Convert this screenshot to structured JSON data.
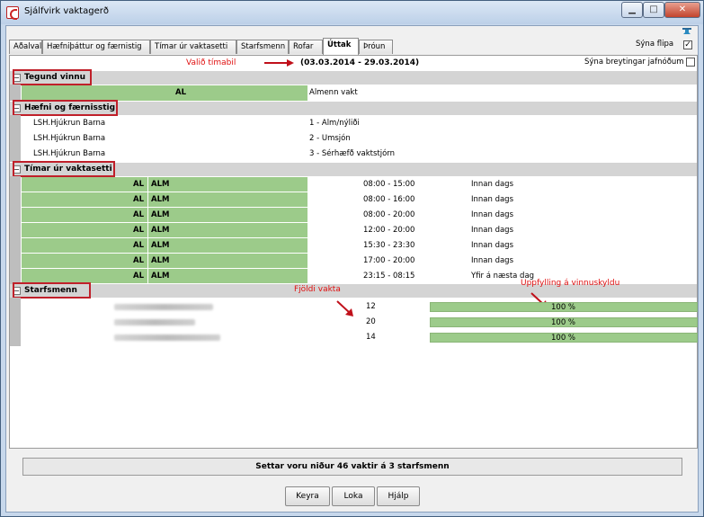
{
  "window": {
    "title": "Sjálfvirk vaktagerð",
    "minimize": "▁",
    "maximize": "□",
    "close": "✕"
  },
  "tabs": [
    {
      "label": "Aðalval"
    },
    {
      "label": "Hæfniþáttur og færnistig"
    },
    {
      "label": "Tímar úr vaktasetti"
    },
    {
      "label": "Starfsmenn"
    },
    {
      "label": "Rofar"
    },
    {
      "label": "Úttak"
    },
    {
      "label": "Þróun"
    }
  ],
  "toolbar": {
    "show_tabs_label": "Sýna flipa",
    "show_tabs_checked": "✓",
    "show_equal_changes_label": "Sýna breytingar jafnóðum"
  },
  "header": {
    "period_annotation": "Valið tímabil",
    "period": "(03.03.2014 - 29.03.2014)"
  },
  "sections": {
    "tegund": {
      "title": "Tegund vinnu",
      "rows": [
        {
          "code": "AL",
          "name": "Almenn vakt"
        }
      ]
    },
    "haefni": {
      "title": "Hæfni og færnisstig",
      "rows": [
        {
          "unit": "LSH.Hjúkrun Barna",
          "level": "1 - Alm/nýliði"
        },
        {
          "unit": "LSH.Hjúkrun Barna",
          "level": "2 - Umsjón"
        },
        {
          "unit": "LSH.Hjúkrun Barna",
          "level": "3 - Sérhæfð vaktstjórn"
        }
      ]
    },
    "timar": {
      "title": "Tímar úr vaktasetti",
      "rows": [
        {
          "code": "AL",
          "sub": "ALM",
          "time": "08:00 - 15:00",
          "type": "Innan dags"
        },
        {
          "code": "AL",
          "sub": "ALM",
          "time": "08:00 - 16:00",
          "type": "Innan dags"
        },
        {
          "code": "AL",
          "sub": "ALM",
          "time": "08:00 - 20:00",
          "type": "Innan dags"
        },
        {
          "code": "AL",
          "sub": "ALM",
          "time": "12:00 - 20:00",
          "type": "Innan dags"
        },
        {
          "code": "AL",
          "sub": "ALM",
          "time": "15:30 - 23:30",
          "type": "Innan dags"
        },
        {
          "code": "AL",
          "sub": "ALM",
          "time": "17:00 - 20:00",
          "type": "Innan dags"
        },
        {
          "code": "AL",
          "sub": "ALM",
          "time": "23:15 - 08:15",
          "type": "Yfir á næsta dag"
        }
      ]
    },
    "starfsmenn": {
      "title": "Starfsmenn",
      "annotation_shifts": "Fjöldi vakta",
      "annotation_fulfillment": "Uppfylling á vinnuskyldu",
      "rows": [
        {
          "shifts": "12",
          "fulfillment": "100 %",
          "fulfillment_value": 100
        },
        {
          "shifts": "20",
          "fulfillment": "100 %",
          "fulfillment_value": 100
        },
        {
          "shifts": "14",
          "fulfillment": "100 %",
          "fulfillment_value": 100
        }
      ]
    }
  },
  "status": "Settar voru niður 46 vaktir á 3 starfsmenn",
  "buttons": {
    "run": "Keyra",
    "close": "Loka",
    "help": "Hjálp"
  },
  "colors": {
    "green_cell": "#9ccb8a",
    "section_header": "#d4d4d4",
    "annotation_red": "#e01010"
  }
}
